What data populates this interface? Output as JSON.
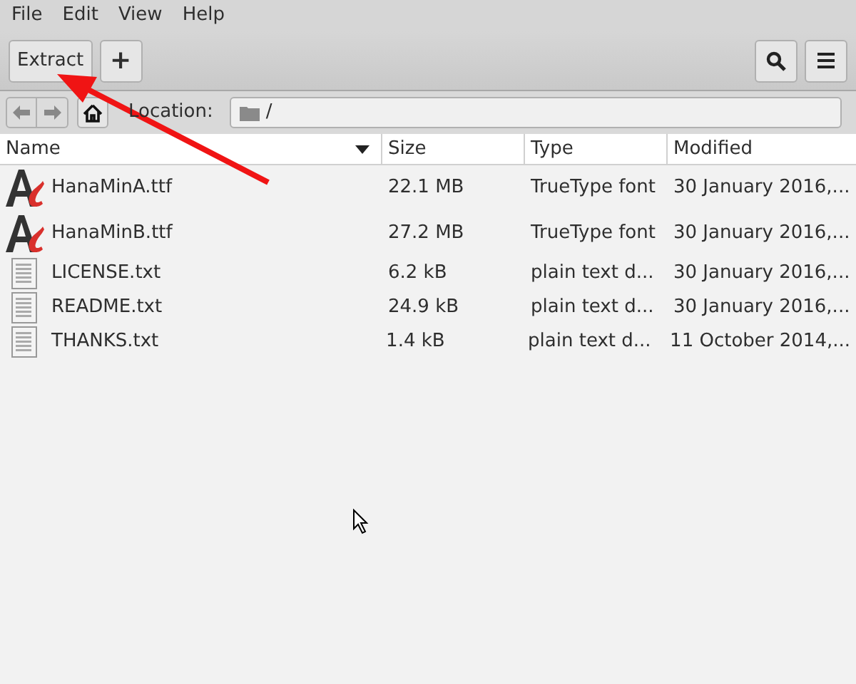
{
  "menu": [
    "File",
    "Edit",
    "View",
    "Help"
  ],
  "toolbar": {
    "extract": "Extract",
    "add": "+"
  },
  "location": {
    "label": "Location:",
    "path": "/"
  },
  "table": {
    "columns": [
      "Name",
      "Size",
      "Type",
      "Modified"
    ],
    "rows": [
      {
        "kind": "font",
        "name": "HanaMinA.ttf",
        "size": "22.1 MB",
        "type": "TrueType font",
        "modified": "30 January 2016,..."
      },
      {
        "kind": "font",
        "name": "HanaMinB.ttf",
        "size": "27.2 MB",
        "type": "TrueType font",
        "modified": "30 January 2016,..."
      },
      {
        "kind": "text",
        "name": "LICENSE.txt",
        "size": "6.2 kB",
        "type": "plain text d...",
        "modified": "30 January 2016,..."
      },
      {
        "kind": "text",
        "name": "README.txt",
        "size": "24.9 kB",
        "type": "plain text d...",
        "modified": "30 January 2016,..."
      },
      {
        "kind": "text",
        "name": "THANKS.txt",
        "size": "1.4 kB",
        "type": "plain text d...",
        "modified": "11 October 2014,..."
      }
    ]
  }
}
